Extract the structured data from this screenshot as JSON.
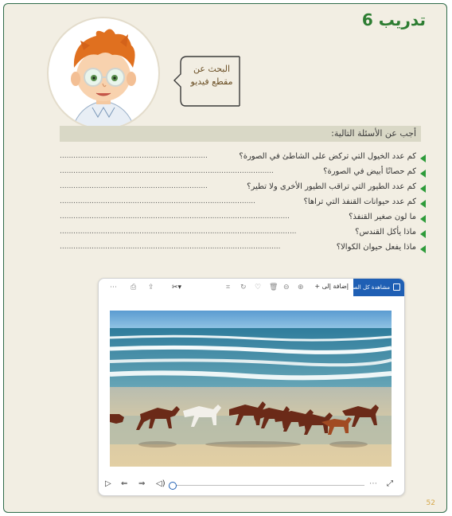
{
  "title": "تدريب 6",
  "bubble": {
    "line1": "البحث عن",
    "line2": "مقطع فيديو"
  },
  "questions_header": "أجب عن الأسئلة التالية:",
  "questions": [
    "كم عدد الخيول التي تركض على الشاطئ في الصورة؟",
    "كم حصانًا أبيض في الصورة؟",
    "كم عدد الطيور التي تراقب الطيور الأخرى ولا تطير؟",
    "كم عدد حيوانات القنفذ التي تراها؟",
    "ما لون صغير القنفذ؟",
    "ماذا يأكل القندس؟",
    "ماذا يفعل حيوان الكوالا؟"
  ],
  "viewer": {
    "view_all_label": "مشاهدة كل الصور",
    "add_to_label": "إضافة إلى"
  },
  "page_number": "52",
  "colors": {
    "title": "#2d7d32",
    "bullet": "#2d9b3a",
    "viewer_accent": "#1f5fb4"
  }
}
